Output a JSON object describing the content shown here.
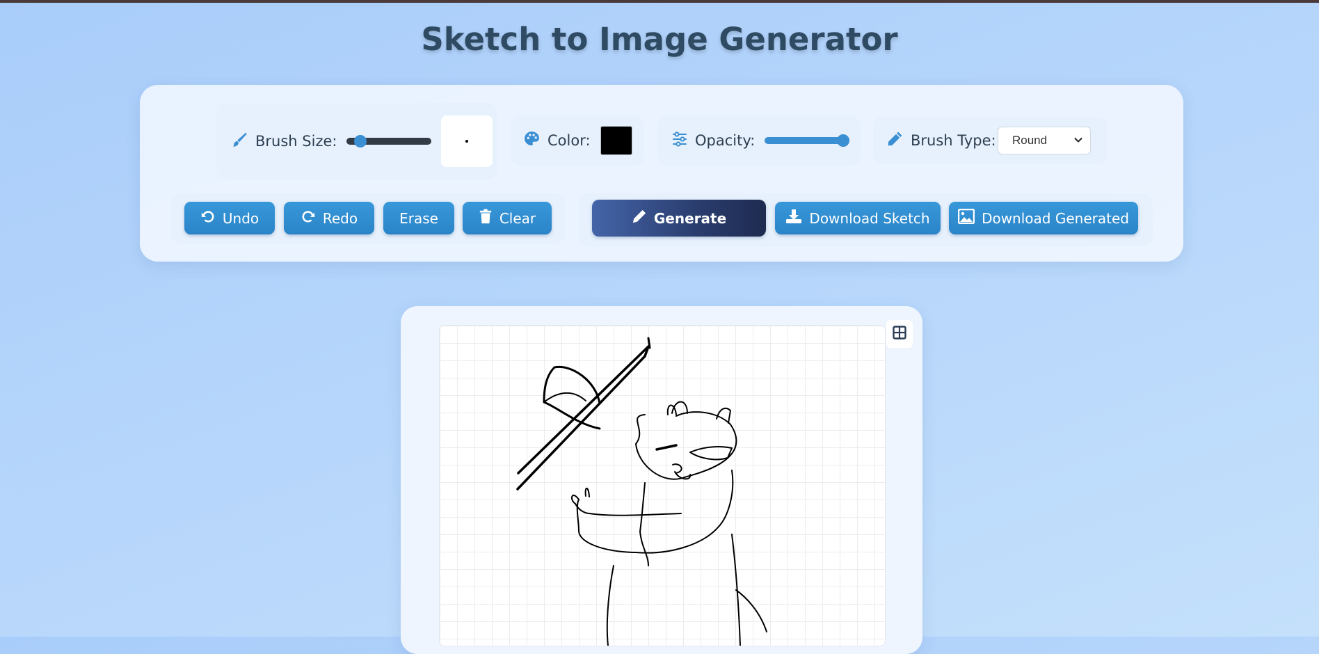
{
  "page": {
    "title": "Sketch to Image Generator"
  },
  "controls": {
    "brush_size": {
      "label": "Brush Size:",
      "level": 0.1
    },
    "color": {
      "label": "Color:",
      "value": "#000000"
    },
    "opacity": {
      "label": "Opacity:",
      "level": 1.0
    },
    "brush_type": {
      "label": "Brush Type:",
      "selected": "Round"
    }
  },
  "actions": {
    "undo": "Undo",
    "redo": "Redo",
    "erase": "Erase",
    "clear": "Clear",
    "generate": "Generate",
    "download_sketch": "Download Sketch",
    "download_generated": "Download Generated"
  },
  "colors": {
    "accent": "#3a8ed2",
    "button": "#2f8bd0",
    "generate_start": "#4464a8",
    "generate_end": "#1e2b50",
    "title": "#2f4a63"
  },
  "icons": {
    "brush_size": "paintbrush-icon",
    "color": "palette-icon",
    "opacity": "sliders-icon",
    "brush_type": "pencil-icon",
    "undo": "undo-icon",
    "redo": "redo-icon",
    "clear": "trash-icon",
    "generate": "pencil-icon",
    "download_sketch": "download-icon",
    "download_generated": "image-icon",
    "grid_toggle": "grid-icon"
  }
}
